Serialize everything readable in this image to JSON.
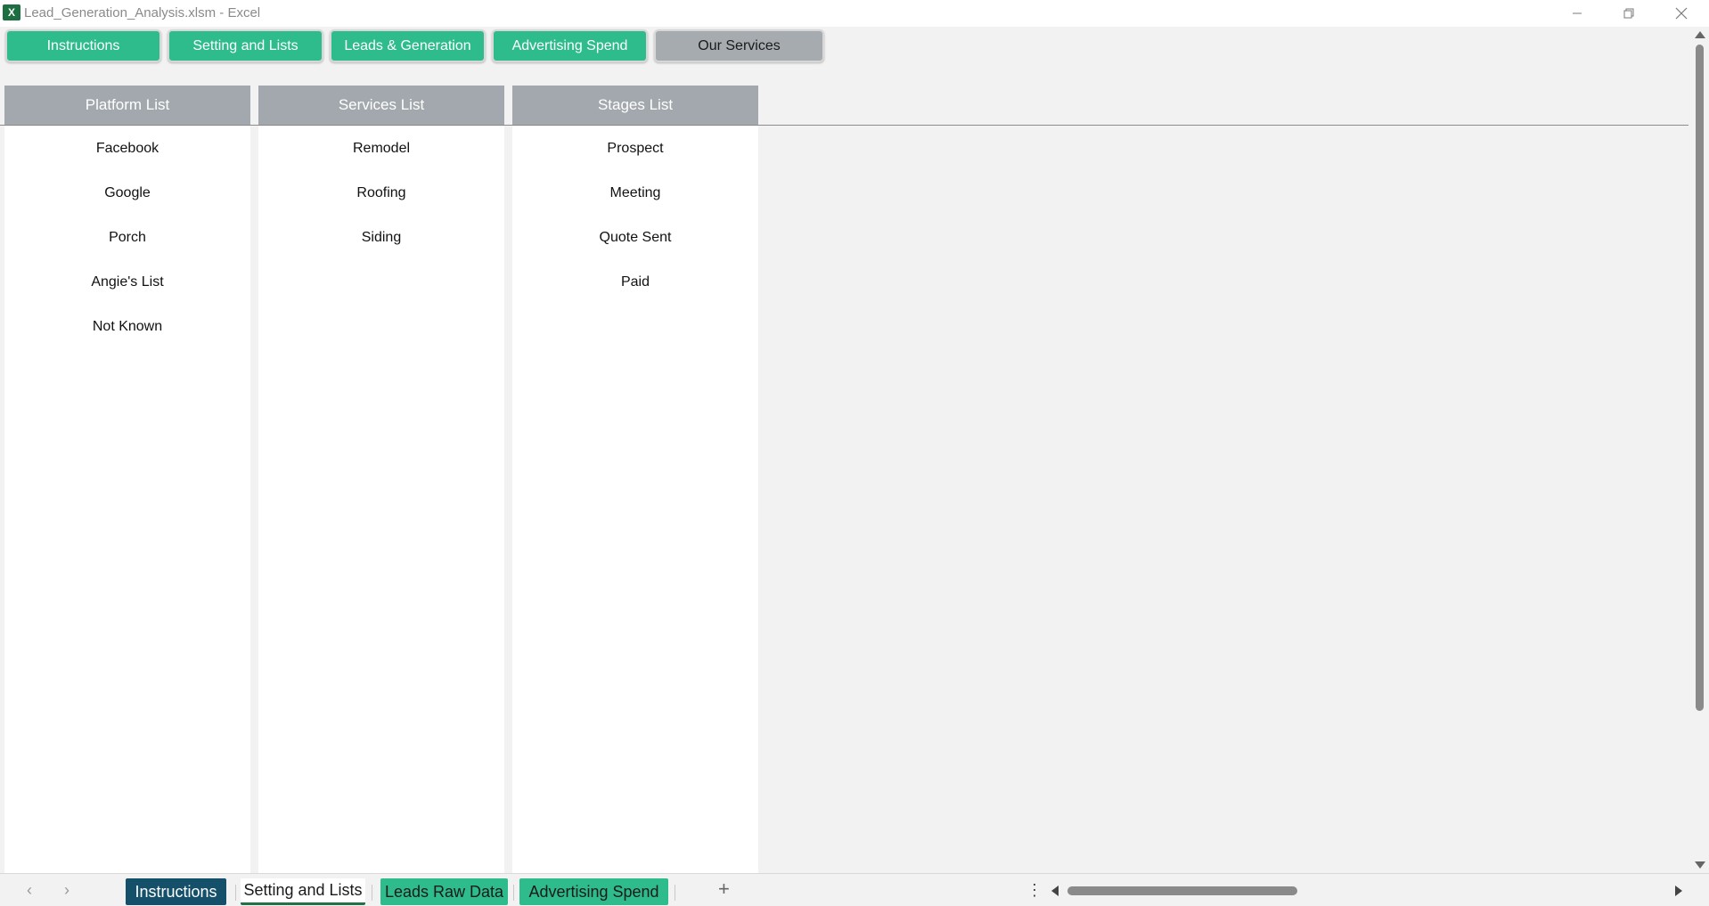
{
  "window": {
    "title": "Lead_Generation_Analysis.xlsm - Excel",
    "app_icon_label": "X"
  },
  "nav_buttons": [
    {
      "label": "Instructions",
      "style": "green"
    },
    {
      "label": "Setting and Lists",
      "style": "green"
    },
    {
      "label": "Leads & Generation",
      "style": "green"
    },
    {
      "label": "Advertising Spend",
      "style": "green"
    },
    {
      "label": "Our Services",
      "style": "gray"
    }
  ],
  "lists": [
    {
      "header": "Platform List",
      "items": [
        "Facebook",
        "Google",
        "Porch",
        "Angie's List",
        "Not Known"
      ]
    },
    {
      "header": "Services List",
      "items": [
        "Remodel",
        "Roofing",
        "Siding"
      ]
    },
    {
      "header": "Stages List",
      "items": [
        "Prospect",
        "Meeting",
        "Quote Sent",
        "Paid"
      ]
    }
  ],
  "sheet_tabs": [
    {
      "label": "Instructions",
      "state": "navy"
    },
    {
      "label": "Setting and Lists",
      "state": "active"
    },
    {
      "label": "Leads Raw Data",
      "state": "green"
    },
    {
      "label": "Advertising Spend",
      "state": "green"
    }
  ],
  "colors": {
    "nav_green": "#2ebc8c",
    "nav_gray": "#a6abb0",
    "header_gray": "#a2a8ad",
    "tab_navy": "#15506b",
    "excel_green": "#217346"
  },
  "icons": {
    "app": "excel-icon",
    "minimize": "minimize-icon",
    "restore": "restore-icon",
    "close": "close-icon",
    "prev_sheet": "chevron-left-icon",
    "next_sheet": "chevron-right-icon",
    "add_sheet": "plus-icon",
    "more": "kebab-icon"
  }
}
